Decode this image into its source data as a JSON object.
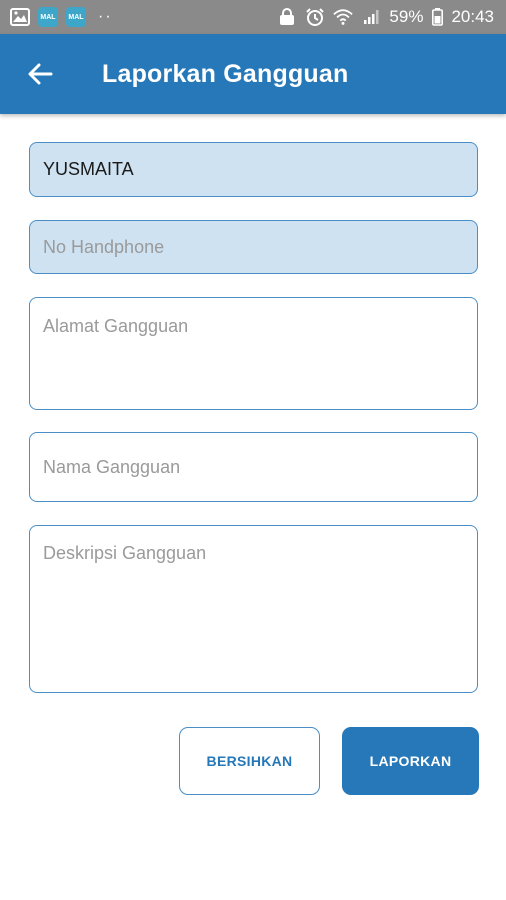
{
  "status_bar": {
    "app_badge_1": "MAL",
    "app_badge_2": "MAL",
    "dots": "··",
    "battery_percent": "59%",
    "time": "20:43"
  },
  "app_bar": {
    "title": "Laporkan Gangguan",
    "back_icon": "arrow-left-icon"
  },
  "form": {
    "name_value": "YUSMAITA",
    "phone_placeholder": "No Handphone",
    "address_placeholder": "Alamat Gangguan",
    "issue_name_placeholder": "Nama Gangguan",
    "description_placeholder": "Deskripsi Gangguan"
  },
  "actions": {
    "clear_label": "BERSIHKAN",
    "submit_label": "LAPORKAN"
  },
  "colors": {
    "primary": "#2678b8",
    "field_filled_bg": "#cfe2f1",
    "field_border": "#4a8ec5",
    "status_bar_bg": "#8a8a8a"
  }
}
